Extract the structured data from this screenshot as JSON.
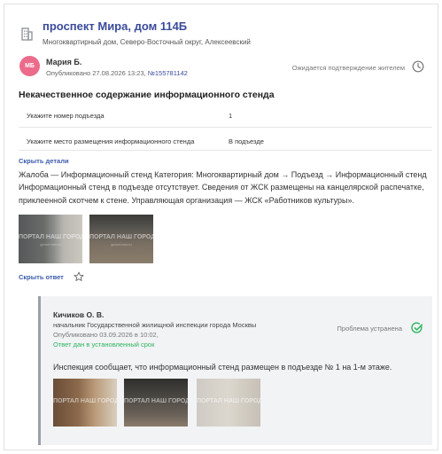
{
  "header": {
    "address_title": "проспект Мира, дом 114Б",
    "address_subtitle": "Многоквартирный дом, Северо-Восточный округ, Алексеевский"
  },
  "author": {
    "initials": "МБ",
    "name": "Мария Б.",
    "published_prefix": "Опубликовано 27.08.2026 13:23,",
    "issue_number": "№155781142",
    "status": "Ожидается подтверждение жителем"
  },
  "issue": {
    "title": "Некачественное содержание информационного стенда",
    "details": [
      {
        "label": "Укажите номер подъезда",
        "value": "1"
      },
      {
        "label": "Укажите место размещения информационного стенда",
        "value": "В подъезде"
      }
    ],
    "hide_details_label": "Скрыть детали",
    "complaint_text": "Жалоба — Информационный стенд Категория: Многоквартирный дом → Подъезд → Информационный стенд Информационный стенд в подъезде отсутствует. Сведения от ЖСК размещены на канцелярской распечатке, приклеенной скотчем к стене. Управляющая организация — ЖСК «Работников культуры».",
    "hide_answer_label": "Скрыть ответ",
    "watermark": "ПОРТАЛ НАШ ГОРОД",
    "watermark_sub": "gorod.mos.ru"
  },
  "reply": {
    "name": "Кичиков О. В.",
    "position": "начальник Государственной жилищной инспекции города Москвы",
    "published": "Опубликовано 03.09.2026 в 10:02,",
    "term_status": "Ответ дан в установленный срок",
    "problem_status": "Проблема устранена",
    "text": "Инспекция сообщает, что информационный стенд размещен в подъезде № 1 на 1-м этаже.",
    "watermark": "ПОРТАЛ НАШ ГОРОД"
  },
  "colors": {
    "accent": "#3b4b9b",
    "avatar": "#ec6b8a",
    "success": "#2bb45f"
  },
  "icons": [
    "building-icon",
    "clock-icon",
    "star-icon",
    "check-circle-icon"
  ]
}
